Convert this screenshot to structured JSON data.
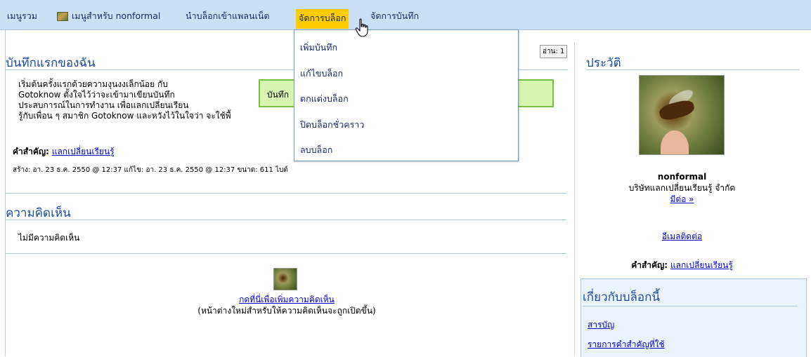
{
  "nav": {
    "items": [
      {
        "label": "เมนูรวม"
      },
      {
        "label": "เมนูสำหรับ nonformal"
      },
      {
        "label": "นำบล็อกเข้าแพลนเน็ต"
      },
      {
        "label": "จัดการบล็อก"
      },
      {
        "label": "จัดการบันทึก"
      }
    ]
  },
  "dropdown": {
    "items": [
      {
        "label": "เพิ่มบันทึก"
      },
      {
        "label": "แก้ไขบล็อก"
      },
      {
        "label": "ตกแต่งบล็อก"
      },
      {
        "label": "ปิดบล็อกชั่วคราว"
      },
      {
        "label": "ลบบล็อก"
      }
    ]
  },
  "post": {
    "title": "บันทึกแรกของฉัน",
    "read_count": "อ่าน: 1",
    "body_lines": [
      "เริ่มต้นครั้งแรกด้วยความงุนงงเล็กน้อย กับ",
      "Gotoknow ตั้งใจไว้ว่าจะเข้ามาเขียนบันทึก",
      "ประสบการณ์ในการทำงาน เพื่อแลกเปลี่ยนเรียน",
      "รู้กับเพื่อน ๆ สมาชิก Gotoknow  และหวังไว้ในใจว่า จะใช้พื้"
    ],
    "greenbox_text": "บันทึก",
    "keywords_label": "คำสำคัญ:",
    "keywords_link": "แลกเปลี่ยนเรียนรู้",
    "meta": "สร้าง: อา. 23 ธ.ค. 2550 @ 12:37   แก้ไข: อา. 23 ธ.ค. 2550 @ 12:37   ขนาด: 611 ไบต์"
  },
  "comments": {
    "title": "ความคิดเห็น",
    "empty_text": "ไม่มีความคิดเห็น",
    "add_link": "กดที่นี่เพื่อเพิ่มความคิดเห็น",
    "add_note": "(หน้าต่างใหม่สำหรับให้ความคิดเห็นจะถูกเปิดขึ้น)"
  },
  "profile": {
    "title": "ประวัติ",
    "name": "nonformal",
    "org": "บริษัทแลกเปลี่ยนเรียนรู้ จำกัด",
    "more_link": "มีต่อ »",
    "email_link": "อีเมลติดต่อ",
    "keywords_label": "คำสำคัญ:",
    "keywords_link": "แลกเปลี่ยนเรียนรู้"
  },
  "about_blog": {
    "title": "เกี่ยวกับบล็อกนี้",
    "links": [
      {
        "label": "สารบัญ"
      },
      {
        "label": "รายการคำสำคัญที่ใช้"
      }
    ]
  },
  "colors": {
    "nav_bg": "#cce0f5",
    "nav_active": "#ffcc00",
    "heading": "#1c4aa0",
    "link": "#0000cc",
    "greenbox_bg": "#d8f5b2",
    "greenbox_border": "#7ac142"
  }
}
